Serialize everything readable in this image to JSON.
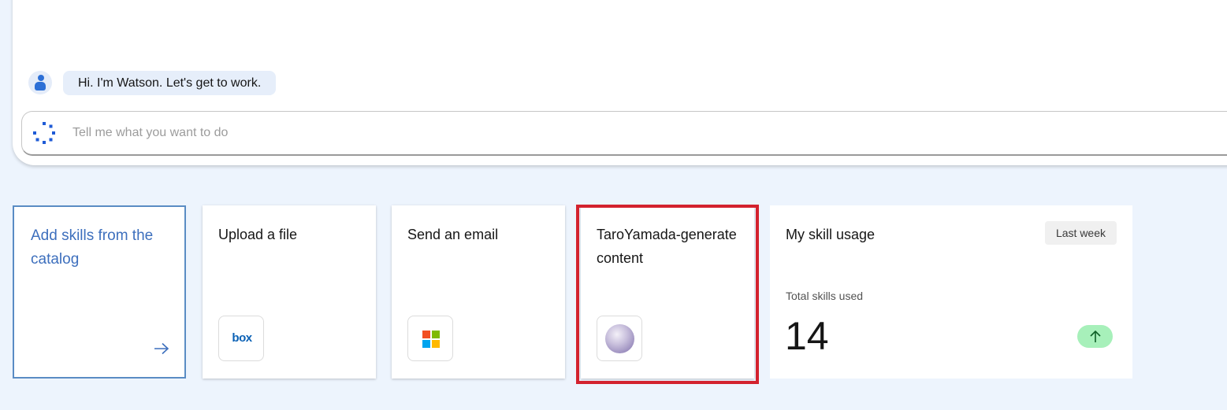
{
  "chat": {
    "greeting": "Hi. I'm Watson. Let's get to work.",
    "avatar_icon": "watson-avatar-icon",
    "prompt": {
      "placeholder": "Tell me what you want to do",
      "value": "",
      "icon": "spinner-icon"
    }
  },
  "cards": {
    "add_skills": {
      "title": "Add skills from the catalog",
      "icon": "arrow-right-icon"
    },
    "upload_file": {
      "title": "Upload a file",
      "logo_text": "box",
      "icon": "box-logo"
    },
    "send_email": {
      "title": "Send an email",
      "icon": "microsoft-logo"
    },
    "generate_content": {
      "title": "TaroYamada-generate content",
      "icon": "custom-skill-orb-icon",
      "highlighted": true
    },
    "skill_usage": {
      "title": "My skill usage",
      "period": "Last week",
      "label": "Total skills used",
      "value": "14",
      "trend_icon": "arrow-up-icon"
    }
  },
  "colors": {
    "page_background": "#edf4fd",
    "accent_blue": "#3d6fbd",
    "highlight_red": "#d3222e",
    "trend_green": "#a7f0ba"
  }
}
